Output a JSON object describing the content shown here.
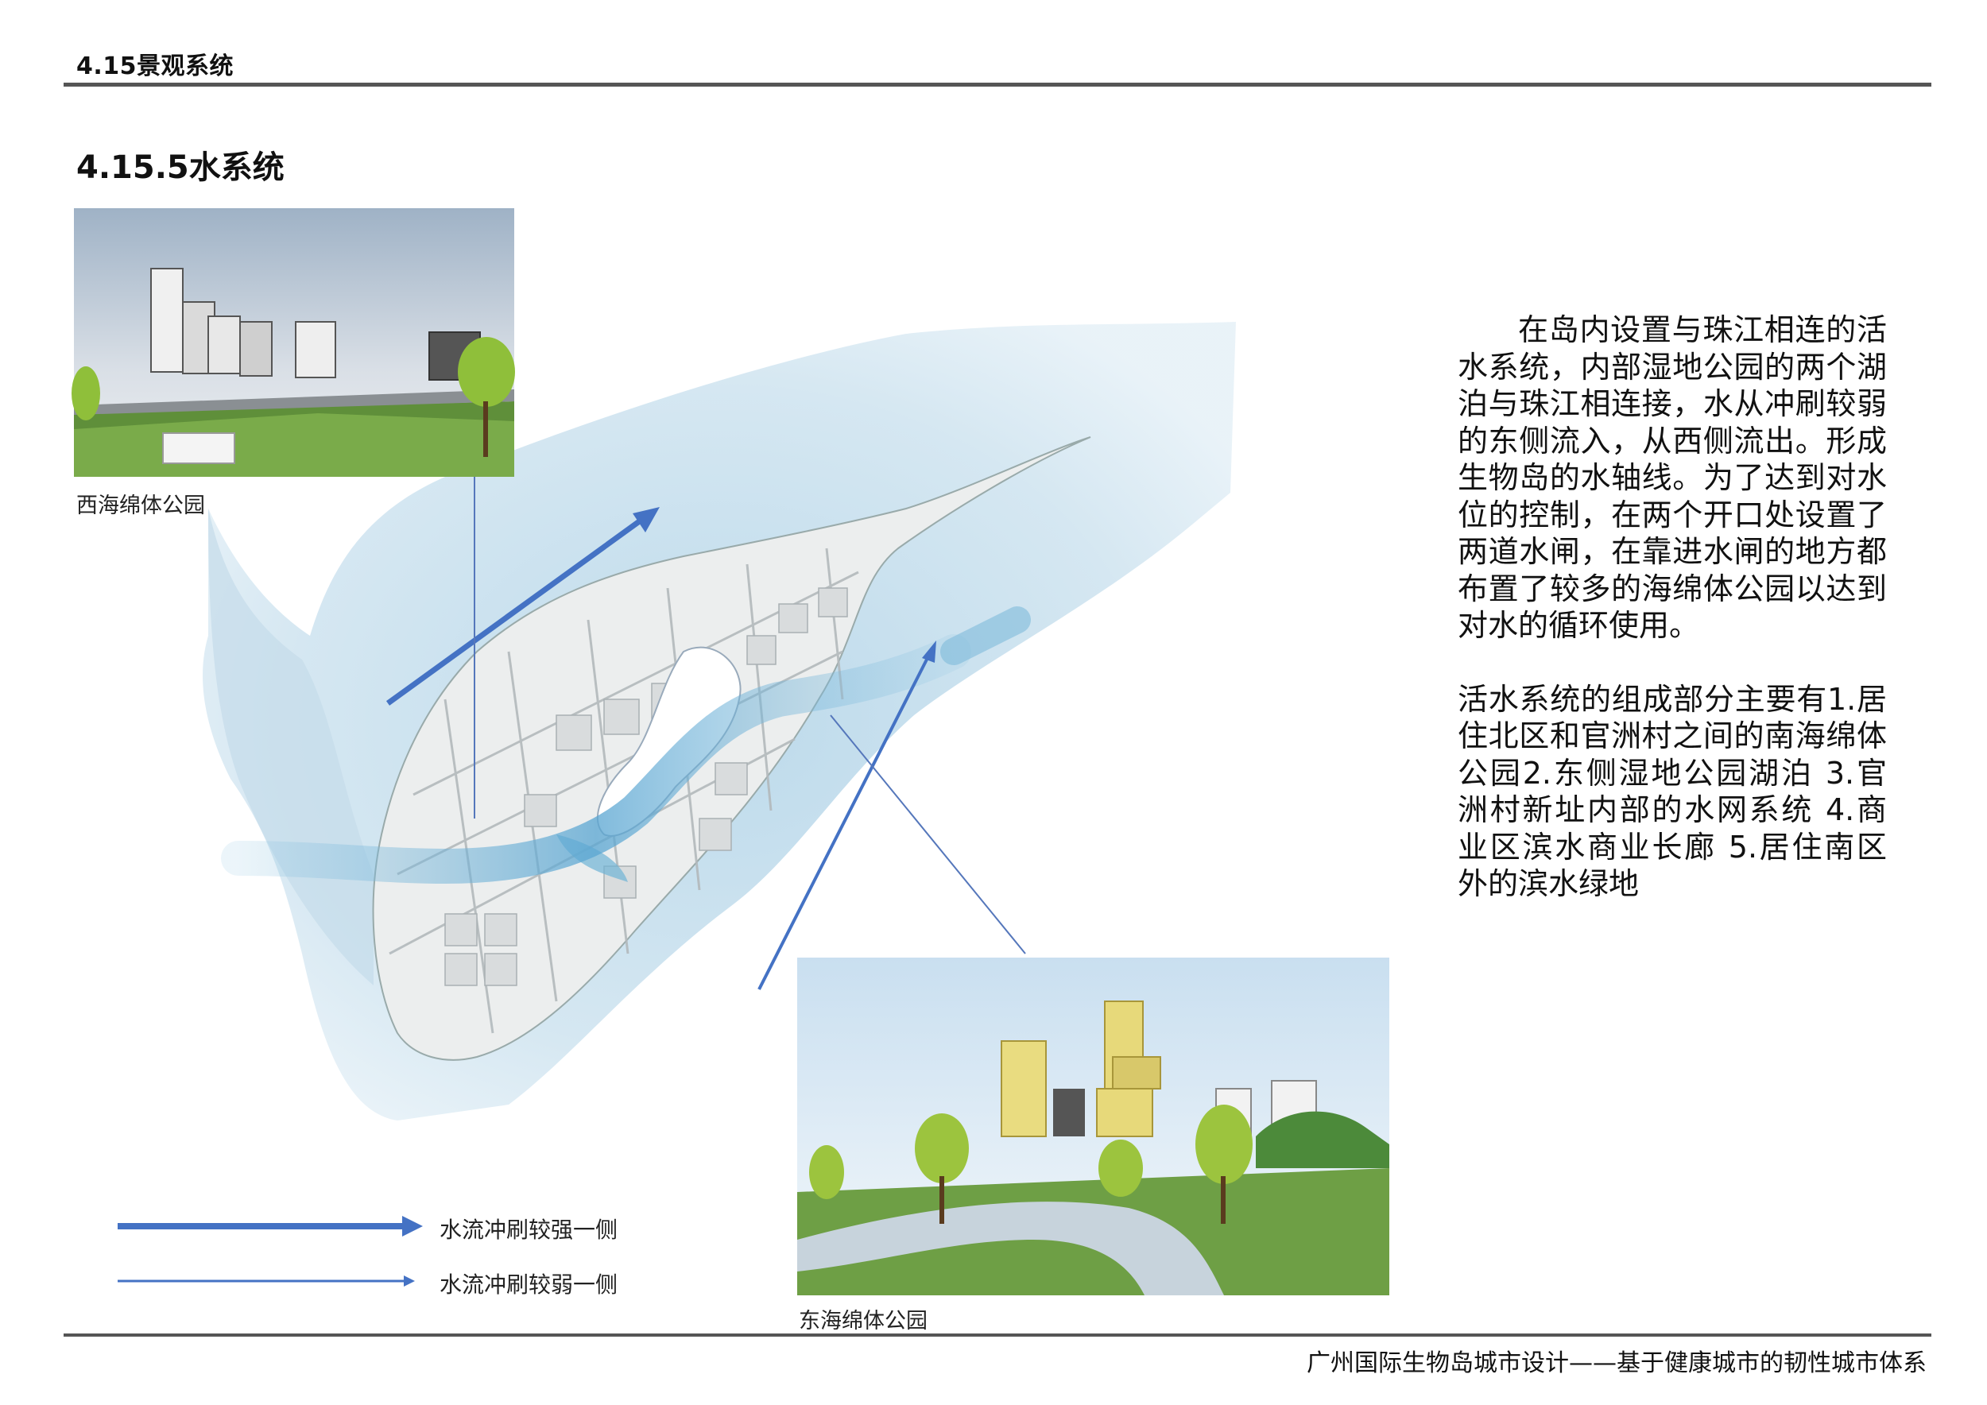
{
  "header": {
    "title": "4.15景观系统"
  },
  "section": {
    "title": "4.15.5水系统"
  },
  "photos": {
    "west": {
      "caption": "西海绵体公园"
    },
    "east": {
      "caption": "东海绵体公园"
    }
  },
  "description": {
    "paragraph1": "在岛内设置与珠江相连的活水系统，内部湿地公园的两个湖泊与珠江相连接，水从冲刷较弱的东侧流入，从西侧流出。形成生物岛的水轴线。为了达到对水位的控制，在两个开口处设置了两道水闸，在靠进水闸的地方都布置了较多的海绵体公园以达到对水的循环使用。",
    "paragraph2": "活水系统的组成部分主要有1.居住北区和官洲村之间的南海绵体公园2.东侧湿地公园湖泊 3.官洲村新址内部的水网系统 4.商业区滨水商业长廊 5.居住南区外的滨水绿地"
  },
  "legend": {
    "strong": {
      "label": "水流冲刷较强一侧",
      "color": "#4472c4"
    },
    "weak": {
      "label": "水流冲刷较弱一侧",
      "color": "#4472c4"
    }
  },
  "footer": {
    "text": "广州国际生物岛城市设计——基于健康城市的韧性城市体系"
  },
  "colors": {
    "water": "#cfe3ef",
    "water_deep": "#6fb3d6",
    "arrow": "#4472c4",
    "rule": "#555555"
  }
}
